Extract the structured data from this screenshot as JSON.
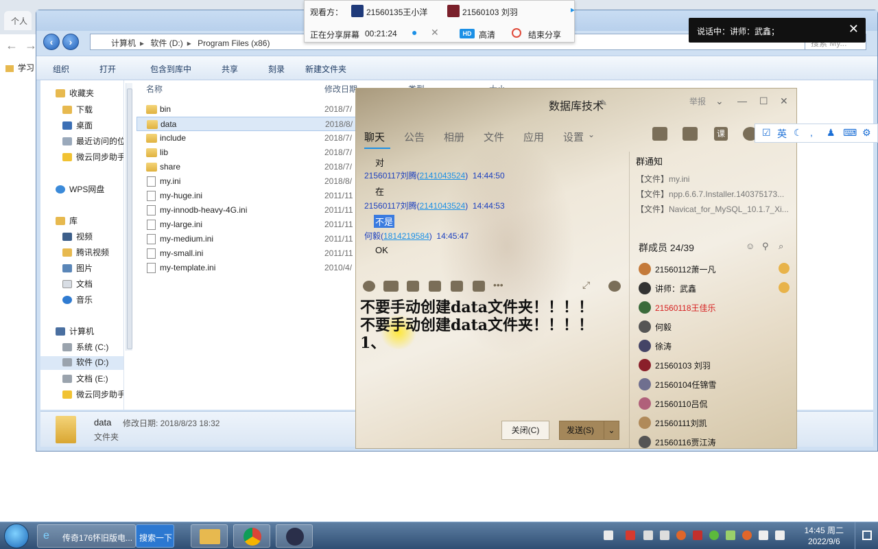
{
  "browser": {
    "tab_label": "个人",
    "bookmark_label": "学习"
  },
  "explorer": {
    "address_parts": [
      "计算机",
      "软件 (D:)",
      "Program Files (x86)"
    ],
    "search_placeholder": "搜索 My...",
    "toolbar": [
      "组织",
      "打开",
      "包含到库中",
      "共享",
      "刻录",
      "新建文件夹"
    ],
    "nav": {
      "favorites": "收藏夹",
      "fav_items": [
        "下载",
        "桌面",
        "最近访问的位置",
        "微云同步助手"
      ],
      "wps": "WPS网盘",
      "library": "库",
      "lib_items": [
        "视频",
        "腾讯视频",
        "图片",
        "文档",
        "音乐"
      ],
      "computer": "计算机",
      "drives": [
        "系统 (C:)",
        "软件 (D:)",
        "文档 (E:)",
        "微云同步助手"
      ]
    },
    "columns": {
      "name": "名称",
      "date": "修改日期",
      "type": "类型",
      "size": "大小"
    },
    "files": [
      {
        "name": "bin",
        "date": "2018/7/",
        "kind": "folder"
      },
      {
        "name": "data",
        "date": "2018/8/",
        "kind": "folder"
      },
      {
        "name": "include",
        "date": "2018/7/",
        "kind": "folder"
      },
      {
        "name": "lib",
        "date": "2018/7/",
        "kind": "folder"
      },
      {
        "name": "share",
        "date": "2018/7/",
        "kind": "folder"
      },
      {
        "name": "my.ini",
        "date": "2018/8/",
        "kind": "ini"
      },
      {
        "name": "my-huge.ini",
        "date": "2011/11",
        "kind": "ini"
      },
      {
        "name": "my-innodb-heavy-4G.ini",
        "date": "2011/11",
        "kind": "ini"
      },
      {
        "name": "my-large.ini",
        "date": "2011/11",
        "kind": "ini"
      },
      {
        "name": "my-medium.ini",
        "date": "2011/11",
        "kind": "ini"
      },
      {
        "name": "my-small.ini",
        "date": "2011/11",
        "kind": "ini"
      },
      {
        "name": "my-template.ini",
        "date": "2010/4/",
        "kind": "ini"
      }
    ],
    "status": {
      "name": "data",
      "meta": "修改日期: 2018/8/23 18:32",
      "type": "文件夹"
    }
  },
  "share_bar": {
    "viewers_label": "观看方：",
    "viewer1": "21560135王小洋",
    "viewer2": "21560103 刘羽",
    "sharing_label": "正在分享屏幕",
    "elapsed": "00:21:24",
    "hd": "HD",
    "hd_label": "高清",
    "end_label": "结束分享"
  },
  "speaking": {
    "text": "说话中：讲师：武鑫；"
  },
  "chat": {
    "title": "数据库技术",
    "report": "举报",
    "tabs": [
      "聊天",
      "公告",
      "相册",
      "文件",
      "应用",
      "设置"
    ],
    "class_label": "课",
    "messages": [
      {
        "body": "对"
      },
      {
        "sender": "21560117刘腾(",
        "qq": "2141043524",
        "suffix": ")",
        "time": "14:44:50"
      },
      {
        "body": "在"
      },
      {
        "sender": "21560117刘腾(",
        "qq": "2141043524",
        "suffix": ")",
        "time": "14:44:53"
      },
      {
        "body": "不是"
      },
      {
        "sender": "何毅(",
        "qq": "1814219584",
        "suffix": ")",
        "time": "14:45:47"
      },
      {
        "body": "OK"
      }
    ],
    "input_lines": [
      "不要手动创建data文件夹！！！！",
      "不要手动创建data文件夹！！！！",
      "1、"
    ],
    "close_btn": "关闭(C)",
    "send_btn": "发送(S)",
    "notice_title": "群通知",
    "notices": [
      {
        "k": "【文件】",
        "v": "my.ini"
      },
      {
        "k": "【文件】",
        "v": "npp.6.6.7.Installer.140375173..."
      },
      {
        "k": "【文件】",
        "v": "Navicat_for_MySQL_10.1.7_Xi..."
      }
    ],
    "members_title": "群成员 24/39",
    "members": [
      {
        "name": "21560112萧一凡",
        "color": "#c47a3a",
        "red": false
      },
      {
        "name": "讲师：武鑫",
        "color": "#333333",
        "red": false
      },
      {
        "name": "21560118王佳乐",
        "color": "#3b6b3b",
        "red": true
      },
      {
        "name": "何毅",
        "color": "#555555",
        "red": false
      },
      {
        "name": "徐涛",
        "color": "#444466",
        "red": false
      },
      {
        "name": "21560103 刘羽",
        "color": "#8a1f2a",
        "red": false
      },
      {
        "name": "21560104任锦雪",
        "color": "#6f6f8f",
        "red": false
      },
      {
        "name": "21560110吕侃",
        "color": "#b0607a",
        "red": false
      },
      {
        "name": "21560111刘凯",
        "color": "#b08a5a",
        "red": false
      },
      {
        "name": "21560116贾江涛",
        "color": "#555555",
        "red": false
      }
    ]
  },
  "ime": {
    "lang": "英"
  },
  "taskbar": {
    "tasks": [
      "传奇176怀旧版电...",
      "搜索一下"
    ],
    "time": "14:45 周二",
    "date": "2022/9/6"
  }
}
